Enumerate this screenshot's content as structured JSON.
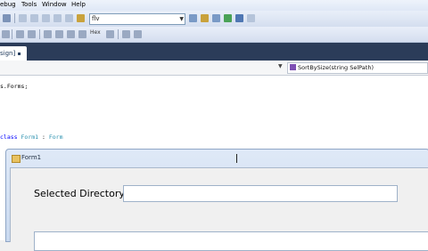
{
  "menu": {
    "items": [
      "ebug",
      "Tools",
      "Window",
      "Help"
    ]
  },
  "toolbar": {
    "config_value": "flv",
    "hex_label": "Hex"
  },
  "document_tab": {
    "label": "sign]"
  },
  "navbar": {
    "member": "SortBySize(string SelPath)"
  },
  "code": {
    "line1": "s.Forms;",
    "line2_keyword": "class",
    "line2_type": "Form1",
    "line2_sep": ":",
    "line2_base": "Form"
  },
  "form": {
    "title": "Form1",
    "selected_directory_label": "Selected Directory:",
    "selected_directory_value": ""
  }
}
